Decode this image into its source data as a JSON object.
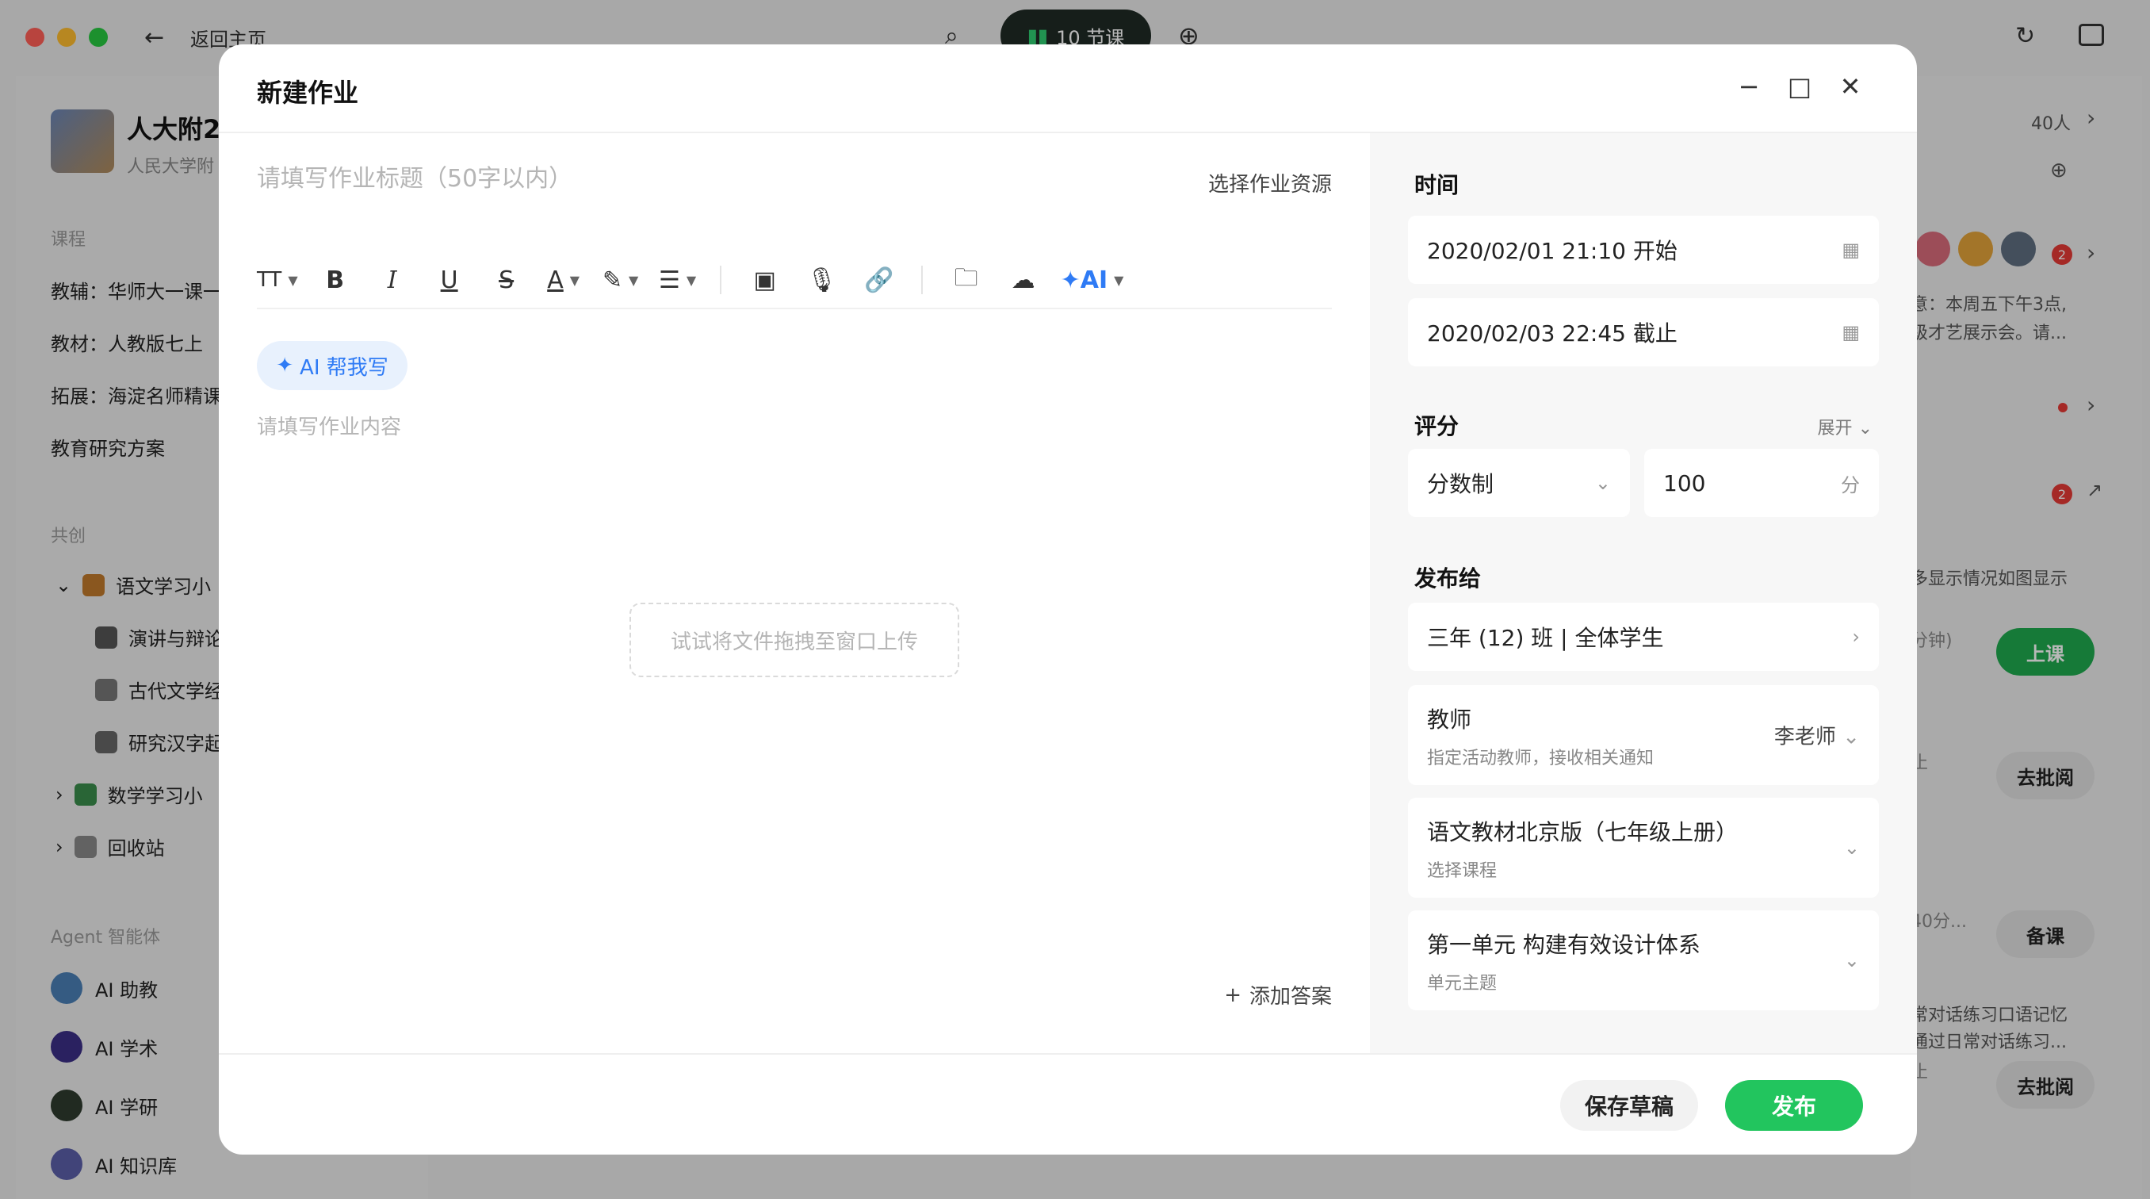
{
  "titlebar": {
    "back_label": "返回主页",
    "lessons_label": "10 节课"
  },
  "sidebar": {
    "school_name": "人大附2",
    "school_sub": "人民大学附",
    "sec_course": "课程",
    "items": [
      "教辅：华师大一课一",
      "教材：人教版七上",
      "拓展：海淀名师精课",
      "教育研究方案"
    ],
    "sec_cocreate": "共创",
    "tree": [
      {
        "label": "语文学习小",
        "color": "#c0792b"
      },
      {
        "label": "演讲与辩论",
        "color": "#555"
      },
      {
        "label": "古代文学经",
        "color": "#777"
      },
      {
        "label": "研究汉字起",
        "color": "#666"
      },
      {
        "label": "数学学习小",
        "color": "#3a8d4c"
      },
      {
        "label": "回收站",
        "color": "#888"
      }
    ],
    "sec_agent": "Agent 智能体",
    "agents": [
      {
        "label": "AI 助教",
        "color": "#4a7fb5"
      },
      {
        "label": "AI 学术",
        "color": "#3b2f86"
      },
      {
        "label": "AI 学研",
        "color": "#2f3b2f"
      },
      {
        "label": "AI 知识库",
        "color": "#5b5fa8"
      }
    ]
  },
  "rightpanel": {
    "count": "40人",
    "notice1": "意：本周五下午3点,",
    "notice2": "级才艺展示会。请...",
    "badge": "2",
    "multi": "多显示情况如图显示",
    "minutes": "分钟)",
    "btn_class": "上课",
    "deadline": "止",
    "btn_review": "去批阅",
    "min40": "40分...",
    "btn_prepare": "备课",
    "talk1": "常对话练习口语记忆",
    "talk2": "通过日常对话练习..."
  },
  "modal": {
    "title": "新建作业",
    "title_placeholder": "请填写作业标题（50字以内）",
    "select_resource": "选择作业资源",
    "toolbar": {
      "text_size": "TT",
      "bold": "B",
      "italic": "I",
      "underline": "U",
      "strike": "S",
      "font_color": "A",
      "ai": "AI"
    },
    "ai_help": "AI 帮我写",
    "content_placeholder": "请填写作业内容",
    "drop_hint": "试试将文件拖拽至窗口上传",
    "add_answer": "添加答案",
    "time_label": "时间",
    "start_time": "2020/02/01 21:10 开始",
    "end_time": "2020/02/03 22:45 截止",
    "score_label": "评分",
    "expand": "展开",
    "score_type": "分数制",
    "score_value": "100",
    "score_unit": "分",
    "publish_to_label": "发布给",
    "publish_to": "三年 (12) 班 | 全体学生",
    "teacher_label": "教师",
    "teacher_sub": "指定活动教师，接收相关通知",
    "teacher_value": "李老师",
    "course_value": "语文教材北京版（七年级上册）",
    "course_sub": "选择课程",
    "unit_value": "第一单元 构建有效设计体系",
    "unit_sub": "单元主题",
    "save_draft": "保存草稿",
    "publish": "发布"
  }
}
